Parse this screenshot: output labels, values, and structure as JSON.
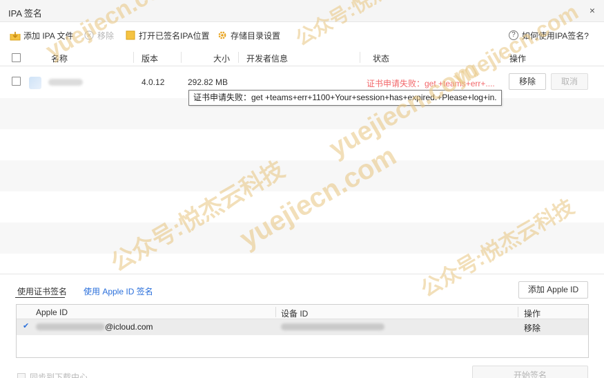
{
  "window": {
    "title": "IPA 签名",
    "close_glyph": "×"
  },
  "toolbar": {
    "add_ipa": "添加 IPA 文件",
    "remove": "移除",
    "open_signed_location": "打开已签名IPA位置",
    "storage_settings": "存储目录设置",
    "help": "如何使用IPA签名?",
    "help_glyph": "?"
  },
  "table": {
    "headers": {
      "name": "名称",
      "version": "版本",
      "size": "大小",
      "developer": "开发者信息",
      "status": "状态",
      "action": "操作"
    },
    "rows": [
      {
        "version": "4.0.12",
        "size": "292.82 MB",
        "status": "证书申请失败：get +teams+err+....",
        "btn_remove": "移除",
        "btn_cancel": "取消"
      }
    ],
    "tooltip": "证书申请失败：get +teams+err+1100+Your+session+has+expired.+Please+log+in."
  },
  "sign_tabs": {
    "cert": "使用证书签名",
    "apple_id": "使用 Apple ID 签名"
  },
  "add_apple_id": "添加 Apple ID",
  "accounts": {
    "headers": {
      "apple_id": "Apple ID",
      "device_id": "设备 ID",
      "action": "操作"
    },
    "rows": [
      {
        "email_suffix": "@icloud.com",
        "action": "移除",
        "selected_glyph": "✔"
      }
    ]
  },
  "sync_label": "同步到下载中心",
  "start_sign": "开始签名",
  "watermarks": [
    "yuejiecn.com",
    "公众号:悦杰云科技"
  ],
  "colors": {
    "accent": "#2a6fdb",
    "error": "#f2676a",
    "folder": "#f5c342",
    "gear": "#e8a21c"
  },
  "icons": [
    "add-file-icon",
    "remove-icon",
    "folder-icon",
    "gear-icon",
    "help-icon",
    "close-icon",
    "checkmark-icon"
  ]
}
